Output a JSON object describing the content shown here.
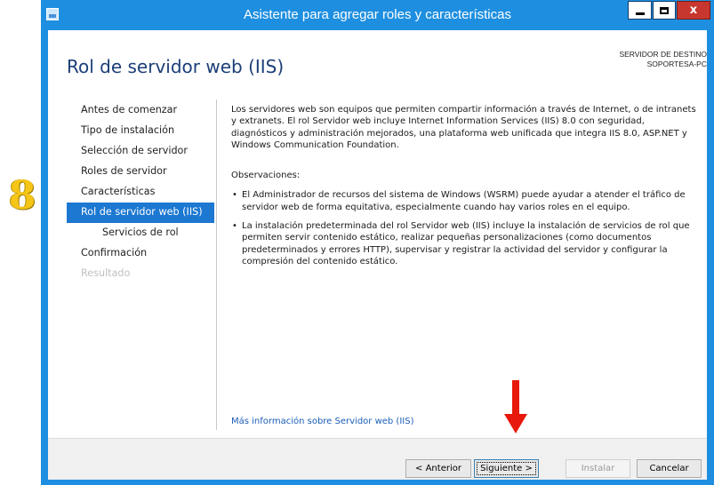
{
  "annotation": {
    "step_number": "8",
    "color": "#f5c518",
    "arrow_color": "#e8180c"
  },
  "window": {
    "title": "Asistente para agregar roles y características",
    "title_bar_color": "#1e8fe0",
    "close_glyph": "x"
  },
  "page": {
    "title": "Rol de servidor web (IIS)"
  },
  "destination": {
    "label": "SERVIDOR DE DESTINO",
    "server": "SOPORTESA-PC"
  },
  "nav": {
    "items": [
      {
        "label": "Antes de comenzar"
      },
      {
        "label": "Tipo de instalación"
      },
      {
        "label": "Selección de servidor"
      },
      {
        "label": "Roles de servidor"
      },
      {
        "label": "Características"
      },
      {
        "label": "Rol de servidor web (IIS)"
      },
      {
        "label": "Servicios de rol"
      },
      {
        "label": "Confirmación"
      },
      {
        "label": "Resultado"
      }
    ],
    "active_index": 5,
    "active_color": "#1c78d1"
  },
  "content": {
    "intro": "Los servidores web son equipos que permiten compartir información a través de Internet, o de intranets y extranets. El rol Servidor web incluye Internet Information Services (IIS) 8.0 con seguridad, diagnósticos y administración mejorados, una plataforma web unificada que integra IIS 8.0, ASP.NET y Windows Communication Foundation.",
    "observations_label": "Observaciones:",
    "bullets": [
      "El Administrador de recursos del sistema de Windows (WSRM) puede ayudar a atender el tráfico de servidor web de forma equitativa, especialmente cuando hay varios roles en el equipo.",
      "La instalación predeterminada del rol Servidor web (IIS) incluye la instalación de servicios de rol que permiten servir contenido estático, realizar pequeñas personalizaciones (como documentos predeterminados y errores HTTP), supervisar y registrar la actividad del servidor y configurar la compresión del contenido estático."
    ],
    "more_info_link": "Más información sobre Servidor web (IIS)"
  },
  "footer": {
    "back_label": "< Anterior",
    "next_label": "Siguiente >",
    "install_label": "Instalar",
    "cancel_label": "Cancelar"
  }
}
